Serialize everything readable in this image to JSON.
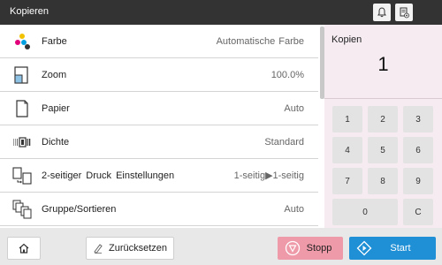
{
  "header": {
    "title": "Kopieren",
    "icons": [
      "bell-icon",
      "device-status-icon"
    ]
  },
  "settings": {
    "rows": [
      {
        "icon": "color-icon",
        "label": "Farbe",
        "value": "Automatische Farbe"
      },
      {
        "icon": "zoom-icon",
        "label": "Zoom",
        "value": "100.0%"
      },
      {
        "icon": "paper-icon",
        "label": "Papier",
        "value": "Auto"
      },
      {
        "icon": "density-icon",
        "label": "Dichte",
        "value": "Standard"
      },
      {
        "icon": "duplex-icon",
        "label": "2-seitiger Druck Einstellungen",
        "value": "1-seitig▶1-seitig"
      },
      {
        "icon": "group-sort-icon",
        "label": "Gruppe/Sortieren",
        "value": "Auto"
      }
    ]
  },
  "copies": {
    "label": "Kopien",
    "value": "1"
  },
  "keypad": {
    "keys": [
      "1",
      "2",
      "3",
      "4",
      "5",
      "6",
      "7",
      "8",
      "9",
      "0",
      "C"
    ]
  },
  "footer": {
    "reset_label": "Zurücksetzen",
    "stop_label": "Stopp",
    "start_label": "Start"
  },
  "colors": {
    "header_bg": "#333333",
    "panel_bg": "#f5ebf1",
    "stop": "#ef9aa9",
    "start": "#1f8fd6"
  }
}
